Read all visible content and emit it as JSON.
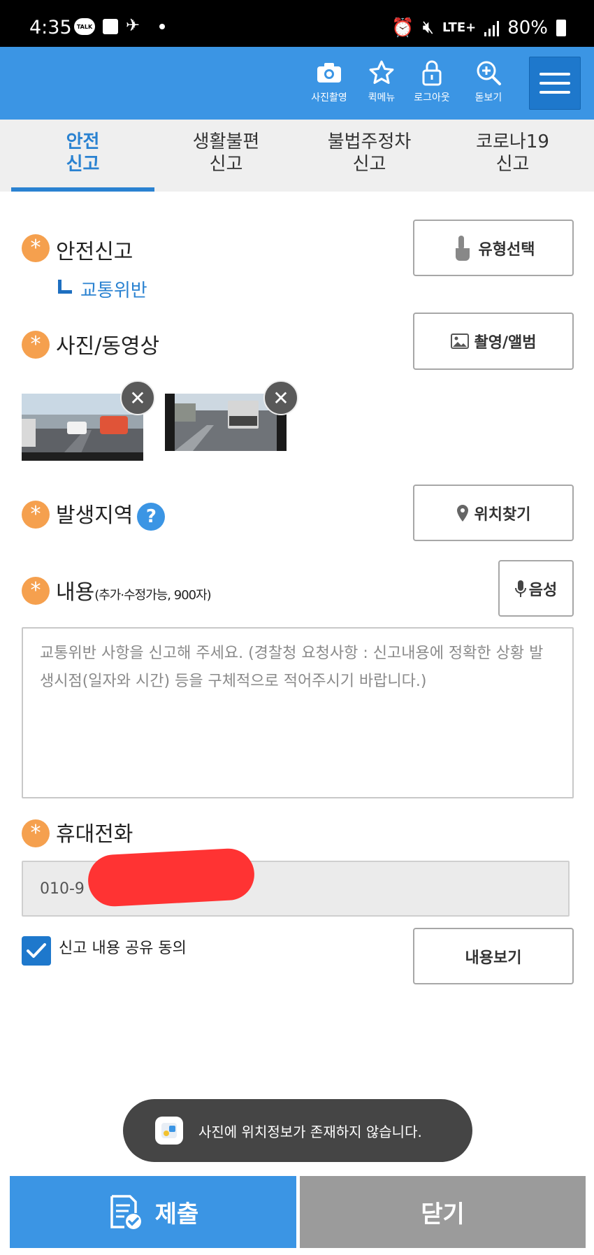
{
  "status_bar": {
    "time": "4:35",
    "talk_badge": "TALK",
    "network": "LTE+",
    "battery": "80%"
  },
  "toolbar": {
    "items": [
      {
        "label": "사진촬영",
        "icon": "camera-icon"
      },
      {
        "label": "퀵메뉴",
        "icon": "star-icon"
      },
      {
        "label": "로그아웃",
        "icon": "lock-icon"
      },
      {
        "label": "돋보기",
        "icon": "zoom-in-icon"
      }
    ],
    "menu_icon": "hamburger-menu-icon"
  },
  "tabs": [
    {
      "line1": "안전",
      "line2": "신고",
      "active": true
    },
    {
      "line1": "생활불편",
      "line2": "신고",
      "active": false
    },
    {
      "line1": "불법주정차",
      "line2": "신고",
      "active": false
    },
    {
      "line1": "코로나19",
      "line2": "신고",
      "active": false
    }
  ],
  "form": {
    "required_mark": "*",
    "report_type": {
      "label": "안전신고",
      "selected_subtype": "교통위반",
      "button": "유형선택"
    },
    "media": {
      "label": "사진/동영상",
      "button": "촬영/앨범",
      "thumbnails": [
        "dashcam-photo-1",
        "dashcam-photo-2"
      ]
    },
    "location": {
      "label": "발생지역",
      "help": "?",
      "button": "위치찾기"
    },
    "content": {
      "label": "내용",
      "label_note": "(추가·수정가능, 900자)",
      "voice_button": "음성",
      "placeholder": "교통위반 사항을 신고해 주세요. (경찰청 요청사항 : 신고내용에 정확한 상황 발생시점(일자와 시간) 등을 구체적으로 적어주시기 바랍니다.)"
    },
    "phone": {
      "label": "휴대전화",
      "value": "010-9"
    },
    "consent": {
      "checked": true,
      "label": "신고 내용 공유 동의",
      "button": "내용보기"
    }
  },
  "toast": {
    "message": "사진에 위치정보가 존재하지 않습니다."
  },
  "bottom_bar": {
    "submit": "제출",
    "close": "닫기"
  },
  "colors": {
    "primary": "#3b95e4",
    "tab_active": "#2a82d1",
    "required": "#f5a04e",
    "close_button": "#9b9b9b"
  }
}
